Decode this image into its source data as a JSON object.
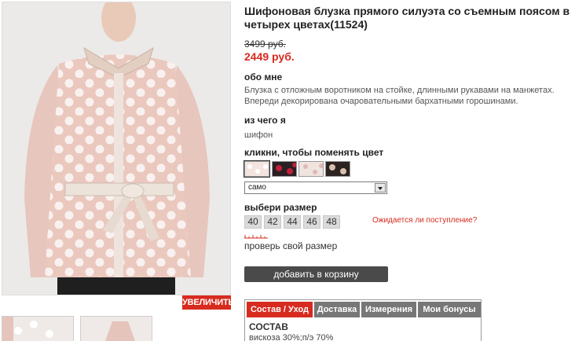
{
  "product": {
    "title": "Шифоновая блузка прямого силуэта со съемным поясом в четырех цветах(11524)",
    "old_price": "3499 руб.",
    "new_price": "2449 руб."
  },
  "about": {
    "heading": "обо мне",
    "text": "Блузка с отложным воротником на стойке, длинными рукавами на манжетах. Впереди декорирована очаровательными бархатными горошинами."
  },
  "material": {
    "heading": "из чего я",
    "text": "шифон"
  },
  "color": {
    "heading": "кликни, чтобы поменять цвет",
    "selected": "само",
    "swatch_icons": [
      "swatch-cream-dots",
      "swatch-black-red",
      "swatch-pink-dots",
      "swatch-black-beige"
    ]
  },
  "size": {
    "heading": "выбери размер",
    "options": [
      "40",
      "42",
      "44",
      "46",
      "48"
    ],
    "await_link": "Ожидается ли поступление?",
    "check_link": "проверь свой размер"
  },
  "gallery": {
    "zoom_label": "УВЕЛИЧИТЬ"
  },
  "cart": {
    "add_label": "добавить в корзину"
  },
  "tabs": {
    "items": [
      "Состав / Уход",
      "Доставка",
      "Измерения",
      "Мои бонусы"
    ],
    "active_index": 0,
    "body_heading": "СОСТАВ",
    "body_text": "вискоза 30%;п/э 70%"
  },
  "colors": {
    "accent": "#d62b1e",
    "button_dark": "#4a4a4a",
    "tab_inactive": "#777777"
  }
}
